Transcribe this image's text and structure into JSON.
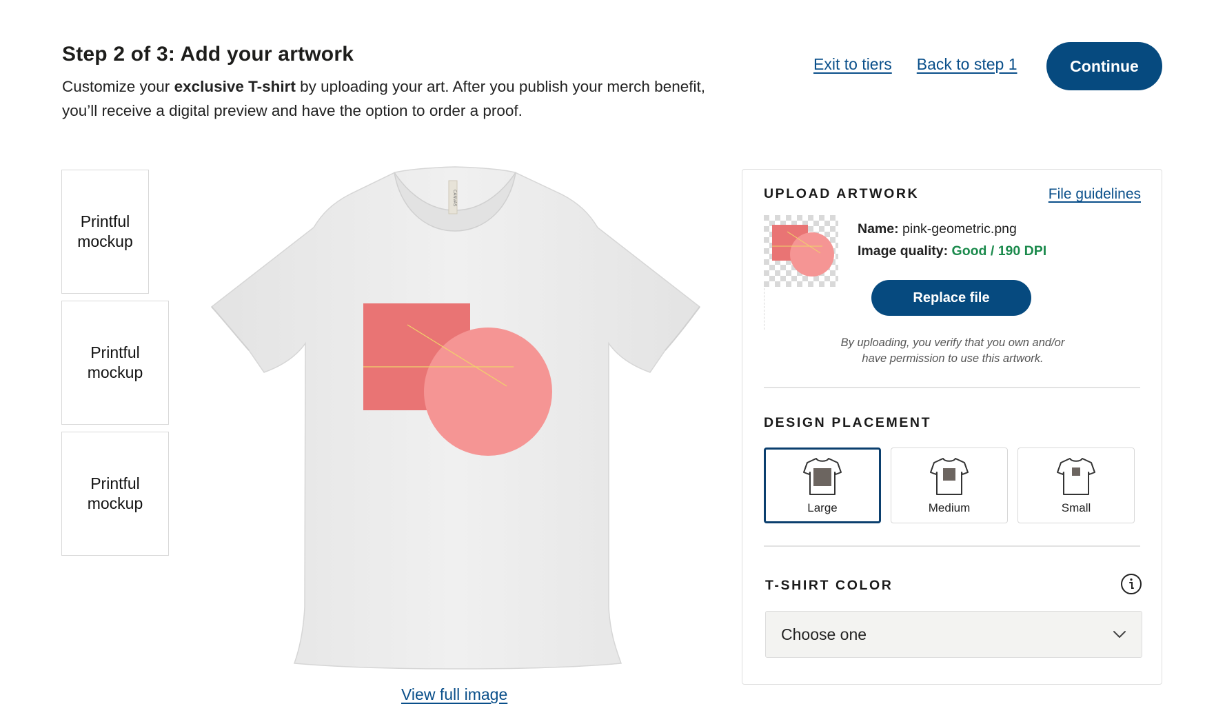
{
  "header": {
    "title": "Step 2 of 3: Add your artwork",
    "desc_prefix": "Customize your ",
    "desc_bold": "exclusive T-shirt",
    "desc_suffix": " by uploading your art. After you publish your merch benefit, you’ll receive a digital preview and have the option to order a proof."
  },
  "nav": {
    "exit_label": "Exit to tiers",
    "back_label": "Back to step 1",
    "continue_label": "Continue"
  },
  "thumbnails": [
    {
      "label": "Printful mockup"
    },
    {
      "label": "Printful mockup"
    },
    {
      "label": "Printful mockup"
    }
  ],
  "preview": {
    "view_full_label": "View full image",
    "tag_text": "CANVAS"
  },
  "upload": {
    "section_label": "UPLOAD ARTWORK",
    "guidelines_label": "File guidelines",
    "name_label": "Name:",
    "name_value": "pink-geometric.png",
    "quality_label": "Image quality:",
    "quality_value": "Good / 190 DPI",
    "replace_label": "Replace file",
    "disclaimer_line1": "By uploading, you verify that you own and/or",
    "disclaimer_line2": "have permission to use this artwork."
  },
  "placement": {
    "section_label": "DESIGN PLACEMENT",
    "options": [
      {
        "label": "Large",
        "selected": true
      },
      {
        "label": "Medium",
        "selected": false
      },
      {
        "label": "Small",
        "selected": false
      }
    ]
  },
  "color": {
    "section_label": "T-SHIRT COLOR",
    "select_value": "Choose one"
  },
  "colors": {
    "primary": "#064a7f",
    "link": "#0a4f8a",
    "quality_good": "#1b8a4c",
    "art_square": "#e97474",
    "art_circle": "#f59594",
    "art_line": "#f0d36a",
    "shirt": "#ededed"
  }
}
